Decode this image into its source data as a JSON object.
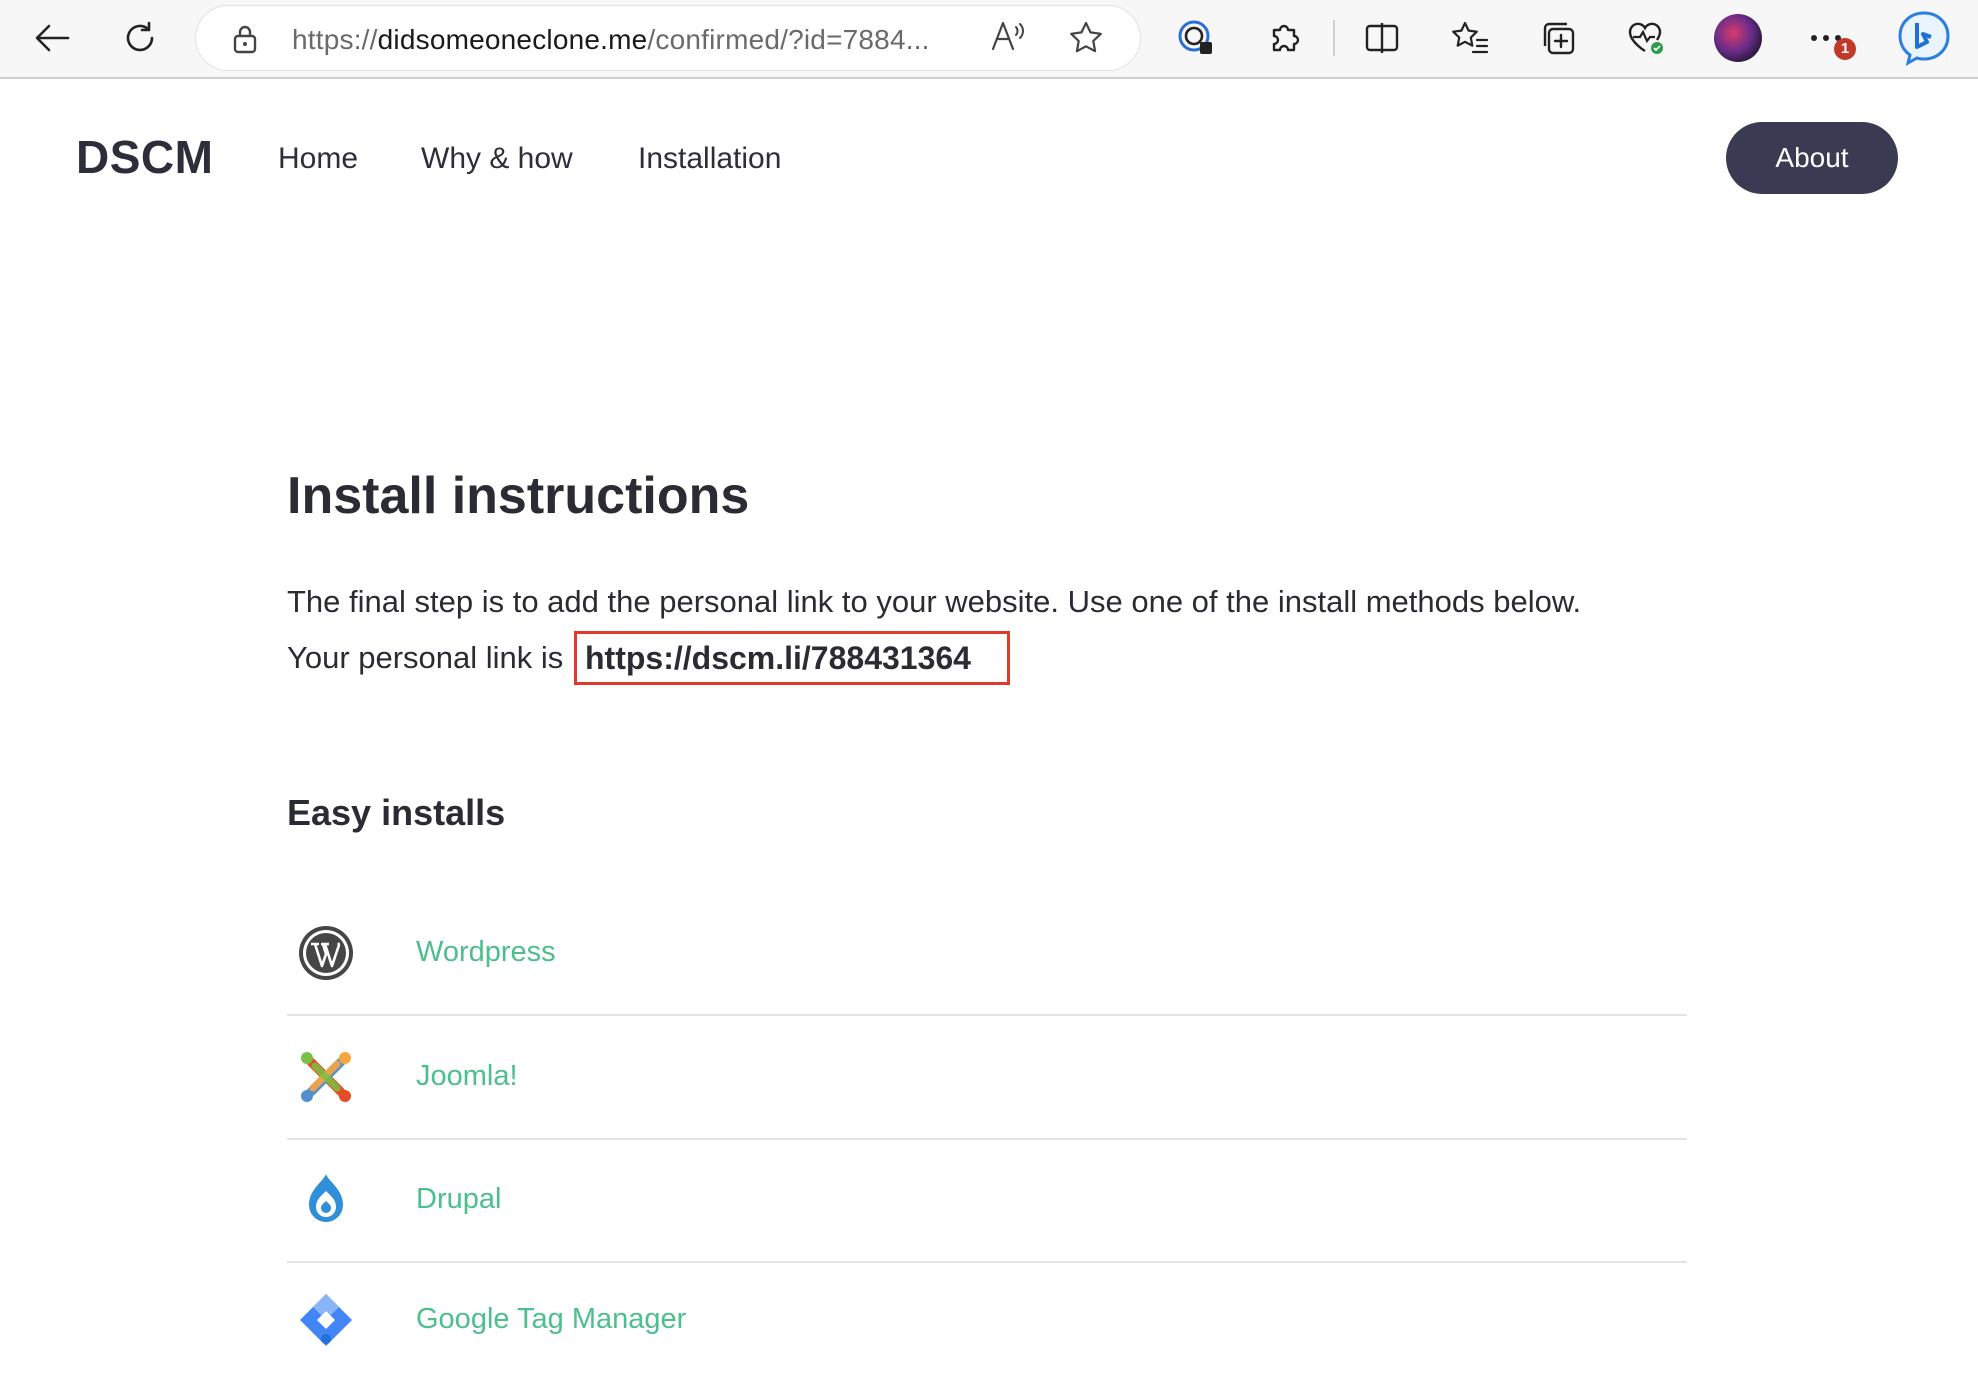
{
  "browser": {
    "url_prefix": "https://",
    "url_domain": "didsomeoneclone.me",
    "url_rest": "/confirmed/?id=7884...",
    "read_aloud_label": "Aᵃ",
    "notification_count": "1",
    "icons": [
      "back-arrow-icon",
      "refresh-icon",
      "lock-icon",
      "read-aloud-icon",
      "favorite-star-icon",
      "tracking-icon",
      "extensions-icon",
      "split-screen-icon",
      "favorites-icon",
      "collections-icon",
      "health-icon",
      "profile-avatar",
      "more-icon",
      "bing-icon"
    ]
  },
  "site": {
    "logo": "DSCM",
    "nav": [
      "Home",
      "Why & how",
      "Installation"
    ],
    "about_label": "About"
  },
  "content": {
    "title": "Install instructions",
    "intro": "The final step is to add the personal link to your website. Use one of the install methods below.",
    "personal_link_prefix": "Your personal link is",
    "personal_link": "https://dscm.li/788431364",
    "easy_installs_title": "Easy installs",
    "installs": [
      {
        "label": "Wordpress",
        "icon": "wordpress-icon"
      },
      {
        "label": "Joomla!",
        "icon": "joomla-icon"
      },
      {
        "label": "Drupal",
        "icon": "drupal-icon"
      },
      {
        "label": "Google Tag Manager",
        "icon": "google-tag-manager-icon"
      }
    ]
  },
  "colors": {
    "accent_green": "#4fbe8d",
    "highlight_red": "#e03a2a",
    "about_button": "#3a3a52"
  }
}
